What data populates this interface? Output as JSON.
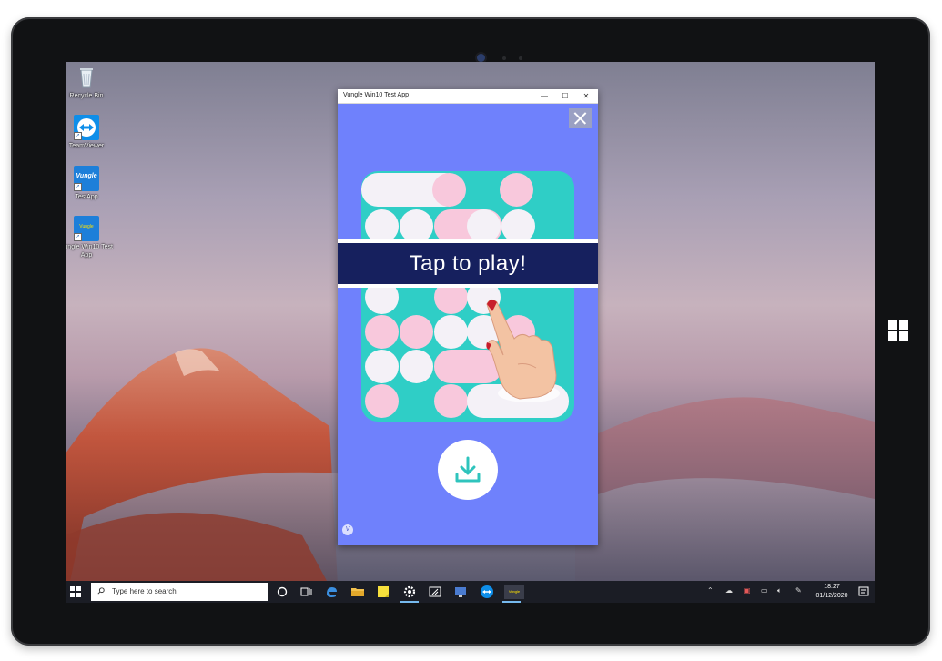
{
  "desktop": {
    "icons": [
      {
        "label": "Recycle Bin"
      },
      {
        "label": "TeamViewer"
      },
      {
        "label": "TestApp",
        "badge": "Vungle"
      },
      {
        "label": "Vungle Win10 Test App",
        "badge": "Vungle"
      }
    ]
  },
  "app_window": {
    "title": "Vungle Win10 Test App",
    "minimize_glyph": "—",
    "maximize_glyph": "☐",
    "close_glyph": "✕"
  },
  "ad": {
    "banner_text": "Tap to play!",
    "close_icon": "close-icon",
    "download_icon": "download-icon",
    "watermark": "V",
    "colors": {
      "background": "#6f81fc",
      "board": "#2fcec6",
      "banner": "#16205e",
      "tile_white": "#f4f1f7",
      "tile_pink": "#f8c8dc",
      "download_accent": "#2fc4bd"
    }
  },
  "taskbar": {
    "search_placeholder": "Type here to search",
    "time": "18:27",
    "date": "01/12/2020",
    "pinned_app_label": "Vungle"
  }
}
